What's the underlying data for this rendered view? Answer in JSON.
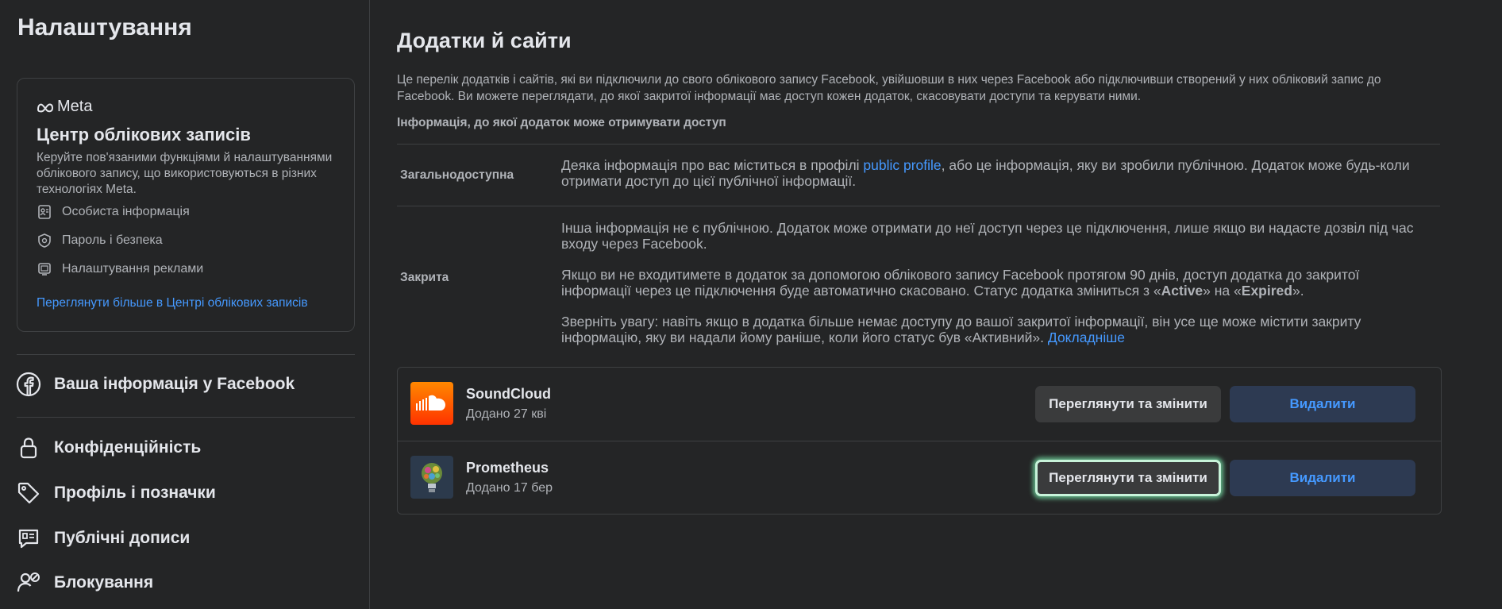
{
  "sidebar": {
    "title": "Налаштування",
    "accounts_center": {
      "logo_text": "Meta",
      "title": "Центр облікових записів",
      "description": "Керуйте пов'язаними функціями й налаштуваннями облікового запису, що використовуються в різних технологіях Meta.",
      "items": [
        {
          "label": "Особиста інформація",
          "icon": "id-card-icon"
        },
        {
          "label": "Пароль і безпека",
          "icon": "shield-icon"
        },
        {
          "label": "Налаштування реклами",
          "icon": "monitor-icon"
        }
      ],
      "link": "Переглянути більше в Центрі облікових записів"
    },
    "your_info": "Ваша інформація у Facebook",
    "nav": [
      {
        "label": "Конфіденційність",
        "icon": "lock-icon"
      },
      {
        "label": "Профіль і позначки",
        "icon": "tag-icon"
      },
      {
        "label": "Публічні дописи",
        "icon": "posts-icon"
      },
      {
        "label": "Блокування",
        "icon": "block-user-icon"
      }
    ]
  },
  "main": {
    "title": "Додатки й сайти",
    "description": "Це перелік додатків і сайтів, які ви підключили до свого облікового запису Facebook, увійшовши в них через Facebook або підключивши створений у них обліковий запис до Facebook. Ви можете переглядати, до якої закритої інформації має доступ кожен додаток, скасовувати доступи та керувати ними.",
    "subheading": "Інформація, до якої додаток може отримувати доступ",
    "public_row": {
      "label": "Загальнодоступна",
      "text_before": "Деяка інформація про вас міститься в профілі ",
      "link": "public profile",
      "text_after": ", або це інформація, яку ви зробили публічною. Додаток може будь-коли отримати доступ до цієї публічної інформації."
    },
    "private_row": {
      "label": "Закрита",
      "p1": "Інша інформація не є публічною. Додаток може отримати до неї доступ через це підключення, лише якщо ви надасте дозвіл під час входу через Facebook.",
      "p2_before": "Якщо ви не входитимете в додаток за допомогою облікового запису Facebook протягом 90 днів, доступ додатка до закритої інформації через це підключення буде автоматично скасовано. Статус додатка зміниться з «",
      "p2_active": "Active",
      "p2_mid": "» на «",
      "p2_expired": "Expired",
      "p2_after": "».",
      "p3": "Зверніть увагу: навіть якщо в додатка більше немає доступу до вашої закритої інформації, він усе ще може містити закриту інформацію, яку ви надали йому раніше, коли його статус був «Активний». ",
      "p3_link": "Докладніше"
    },
    "apps": [
      {
        "name": "SoundCloud",
        "added": "Додано 27 кві",
        "view": "Переглянути та змінити",
        "remove": "Видалити",
        "icon": "soundcloud-icon"
      },
      {
        "name": "Prometheus",
        "added": "Додано 17 бер",
        "view": "Переглянути та змінити",
        "remove": "Видалити",
        "icon": "prometheus-icon"
      }
    ]
  },
  "colors": {
    "background": "#242526",
    "text_primary": "#e4e6eb",
    "text_secondary": "#b0b3b8",
    "link": "#4599ff",
    "divider": "#3e4042",
    "button_secondary": "#3a3b3c",
    "button_remove": "#2d3a52",
    "focus_glow": "#78e6aa"
  }
}
